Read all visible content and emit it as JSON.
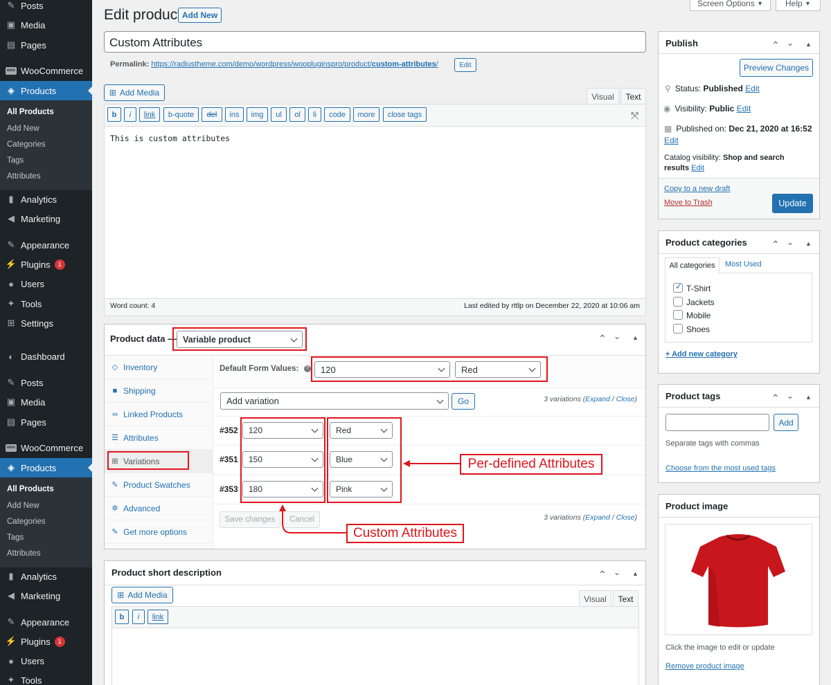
{
  "sidebar": {
    "group1": [
      {
        "label": "Posts",
        "icon": "pin-icon"
      },
      {
        "label": "Media",
        "icon": "media-icon"
      },
      {
        "label": "Pages",
        "icon": "pages-icon"
      },
      {
        "label": "WooCommerce",
        "icon": "woo-icon"
      },
      {
        "label": "Products",
        "icon": "box-icon"
      }
    ],
    "products_sub": [
      "All Products",
      "Add New",
      "Categories",
      "Tags",
      "Attributes"
    ],
    "group2": [
      {
        "label": "Analytics"
      },
      {
        "label": "Marketing"
      },
      {
        "label": "Appearance"
      },
      {
        "label": "Plugins",
        "badge": "1"
      },
      {
        "label": "Users"
      },
      {
        "label": "Tools"
      },
      {
        "label": "Settings"
      },
      {
        "label": "Dashboard"
      }
    ],
    "group3": [
      {
        "label": "Posts"
      },
      {
        "label": "Media"
      },
      {
        "label": "Pages"
      },
      {
        "label": "WooCommerce"
      },
      {
        "label": "Products"
      }
    ],
    "products_sub2": [
      "All Products",
      "Add New",
      "Categories",
      "Tags",
      "Attributes"
    ],
    "group4": [
      {
        "label": "Analytics"
      },
      {
        "label": "Marketing"
      },
      {
        "label": "Appearance"
      },
      {
        "label": "Plugins",
        "badge": "1"
      },
      {
        "label": "Users"
      },
      {
        "label": "Tools"
      }
    ]
  },
  "topbar": {
    "screen_options": "Screen Options",
    "help": "Help"
  },
  "page": {
    "title": "Edit product",
    "add_new": "Add New",
    "product_title": "Custom Attributes",
    "permalink_label": "Permalink:",
    "permalink_base": "https://radiustheme.com/demo/wordpress/woopluginspro/product/",
    "permalink_slug": "custom-attributes",
    "permalink_end": "/",
    "permalink_edit": "Edit"
  },
  "editor": {
    "add_media": "Add Media",
    "tab_visual": "Visual",
    "tab_text": "Text",
    "quicktags": [
      "b",
      "i",
      "link",
      "b-quote",
      "del",
      "ins",
      "img",
      "ul",
      "ol",
      "li",
      "code",
      "more",
      "close tags"
    ],
    "content": "This is custom attributes",
    "word_count": "Word count: 4",
    "last_edited": "Last edited by rttlp on December 22, 2020 at 10:06 am"
  },
  "product_data": {
    "label": "Product data —",
    "type": "Variable product",
    "tabs": [
      "Inventory",
      "Shipping",
      "Linked Products",
      "Attributes",
      "Variations",
      "Product Swatches",
      "Advanced",
      "Get more options"
    ],
    "default_label": "Default Form Values:",
    "default_size": "120",
    "default_color": "Red",
    "add_variation": "Add variation",
    "go": "Go",
    "count_text": "3 variations",
    "expand": "Expand",
    "close": "Close",
    "variations": [
      {
        "id": "#352",
        "size": "120",
        "color": "Red"
      },
      {
        "id": "#351",
        "size": "150",
        "color": "Blue"
      },
      {
        "id": "#353",
        "size": "180",
        "color": "Pink"
      }
    ],
    "save": "Save changes",
    "cancel": "Cancel"
  },
  "annotations": {
    "predefined": "Per-defined Attributes",
    "custom": "Custom Attributes"
  },
  "short_desc": {
    "title": "Product short description",
    "add_media": "Add Media",
    "tab_visual": "Visual",
    "tab_text": "Text",
    "quicktags": [
      "b",
      "i",
      "link"
    ]
  },
  "publish": {
    "title": "Publish",
    "preview": "Preview Changes",
    "status_label": "Status:",
    "status": "Published",
    "visibility_label": "Visibility:",
    "visibility": "Public",
    "published_label": "Published on:",
    "published": "Dec 21, 2020 at 16:52",
    "catalog_label": "Catalog visibility:",
    "catalog": "Shop and search results",
    "edit": "Edit",
    "copy": "Copy to a new draft",
    "trash": "Move to Trash",
    "update": "Update"
  },
  "categories": {
    "title": "Product categories",
    "tab_all": "All categories",
    "tab_used": "Most Used",
    "items": [
      {
        "label": "T-Shirt",
        "checked": true
      },
      {
        "label": "Jackets",
        "checked": false
      },
      {
        "label": "Mobile",
        "checked": false
      },
      {
        "label": "Shoes",
        "checked": false
      }
    ],
    "add_new": "+ Add new category"
  },
  "tags": {
    "title": "Product tags",
    "add": "Add",
    "hint": "Separate tags with commas",
    "choose": "Choose from the most used tags"
  },
  "image": {
    "title": "Product image",
    "hint": "Click the image to edit or update",
    "remove": "Remove product image"
  },
  "colors": {
    "accent": "#2271b1",
    "update_btn": "#2271b1",
    "highlight": "#e0151b",
    "tshirt": "#c8161d"
  }
}
